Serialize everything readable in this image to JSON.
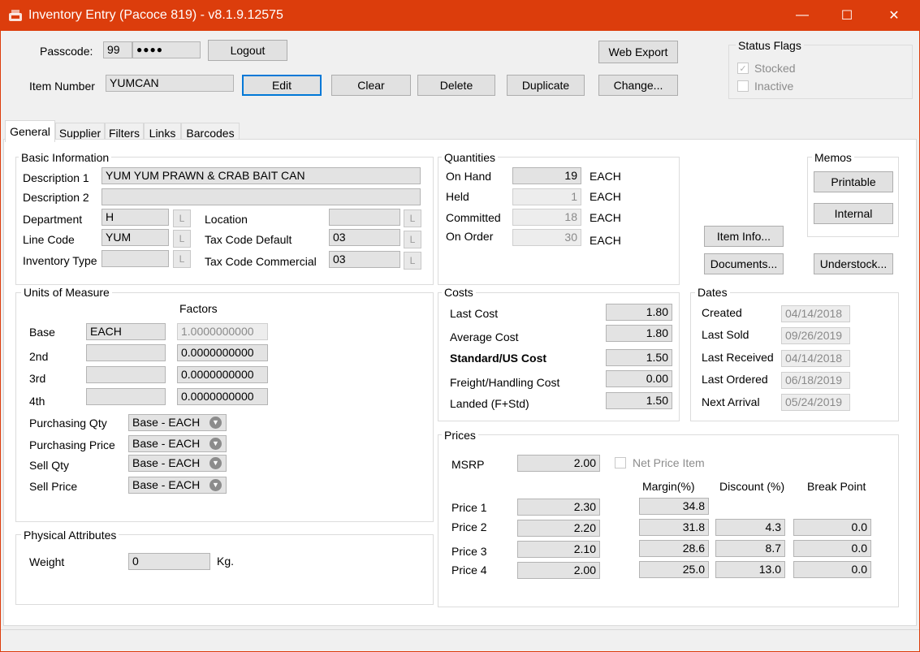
{
  "window": {
    "title": "Inventory Entry (Pacoce 819) - v8.1.9.12575",
    "minimize": "—",
    "maximize": "☐",
    "close": "✕"
  },
  "header": {
    "passcode_label": "Passcode:",
    "passcode_user": "99",
    "passcode_masked": "●●●●",
    "logout": "Logout",
    "web_export": "Web Export",
    "item_number_label": "Item Number",
    "item_number": "YUMCAN",
    "edit": "Edit",
    "clear": "Clear",
    "delete": "Delete",
    "duplicate": "Duplicate",
    "change": "Change..."
  },
  "status_flags": {
    "title": "Status Flags",
    "stocked": "Stocked",
    "stocked_checked": true,
    "inactive": "Inactive",
    "inactive_checked": false
  },
  "tabs": [
    "General",
    "Supplier",
    "Filters",
    "Links",
    "Barcodes"
  ],
  "basic": {
    "title": "Basic Information",
    "desc1_label": "Description 1",
    "desc1": "YUM YUM PRAWN & CRAB BAIT CAN",
    "desc2_label": "Description 2",
    "desc2": "",
    "department_label": "Department",
    "department": "H",
    "location_label": "Location",
    "location": "",
    "line_code_label": "Line Code",
    "line_code": "YUM",
    "tax_default_label": "Tax Code Default",
    "tax_default": "03",
    "inv_type_label": "Inventory Type",
    "inv_type": "",
    "tax_commercial_label": "Tax Code Commercial",
    "tax_commercial": "03",
    "lookup": "L"
  },
  "quantities": {
    "title": "Quantities",
    "on_hand_label": "On Hand",
    "on_hand": "19",
    "held_label": "Held",
    "held": "1",
    "committed_label": "Committed",
    "committed": "18",
    "on_order_label": "On Order",
    "on_order": "30",
    "unit": "EACH"
  },
  "memos": {
    "title": "Memos",
    "printable": "Printable",
    "internal": "Internal"
  },
  "actions": {
    "item_info": "Item Info...",
    "documents": "Documents...",
    "understock": "Understock..."
  },
  "uom": {
    "title": "Units of Measure",
    "factors_label": "Factors",
    "base_label": "Base",
    "base": "EACH",
    "base_factor": "1.0000000000",
    "second_label": "2nd",
    "second": "",
    "second_factor": "0.0000000000",
    "third_label": "3rd",
    "third": "",
    "third_factor": "0.0000000000",
    "fourth_label": "4th",
    "fourth": "",
    "fourth_factor": "0.0000000000",
    "purchasing_qty_label": "Purchasing Qty",
    "purchasing_qty": "Base - EACH",
    "purchasing_price_label": "Purchasing Price",
    "purchasing_price": "Base - EACH",
    "sell_qty_label": "Sell Qty",
    "sell_qty": "Base - EACH",
    "sell_price_label": "Sell Price",
    "sell_price": "Base - EACH"
  },
  "costs": {
    "title": "Costs",
    "last_cost_label": "Last Cost",
    "last_cost": "1.80",
    "avg_cost_label": "Average Cost",
    "avg_cost": "1.80",
    "std_cost_label": "Standard/US Cost",
    "std_cost": "1.50",
    "freight_label": "Freight/Handling Cost",
    "freight": "0.00",
    "landed_label": "Landed (F+Std)",
    "landed": "1.50"
  },
  "dates": {
    "title": "Dates",
    "created_label": "Created",
    "created": "04/14/2018",
    "last_sold_label": "Last Sold",
    "last_sold": "09/26/2019",
    "last_received_label": "Last Received",
    "last_received": "04/14/2018",
    "last_ordered_label": "Last Ordered",
    "last_ordered": "06/18/2019",
    "next_arrival_label": "Next Arrival",
    "next_arrival": "05/24/2019"
  },
  "physical": {
    "title": "Physical Attributes",
    "weight_label": "Weight",
    "weight": "0",
    "unit": "Kg."
  },
  "prices": {
    "title": "Prices",
    "msrp_label": "MSRP",
    "msrp": "2.00",
    "net_price_label": "Net Price Item",
    "net_price_checked": false,
    "margin_header": "Margin(%)",
    "discount_header": "Discount (%)",
    "break_header": "Break Point",
    "rows": [
      {
        "label": "Price 1",
        "price": "2.30",
        "margin": "34.8",
        "discount": "",
        "break": ""
      },
      {
        "label": "Price 2",
        "price": "2.20",
        "margin": "31.8",
        "discount": "4.3",
        "break": "0.0"
      },
      {
        "label": "Price 3",
        "price": "2.10",
        "margin": "28.6",
        "discount": "8.7",
        "break": "0.0"
      },
      {
        "label": "Price 4",
        "price": "2.00",
        "margin": "25.0",
        "discount": "13.0",
        "break": "0.0"
      }
    ]
  },
  "colors": {
    "titlebar": "#dc3d0c",
    "focus": "#0078d7"
  }
}
